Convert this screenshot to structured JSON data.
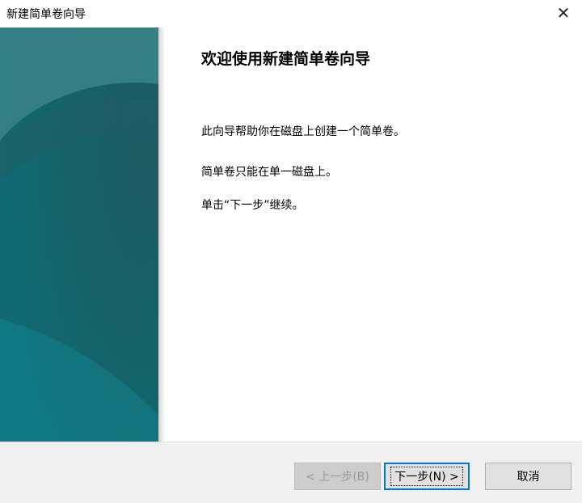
{
  "window": {
    "title": "新建简单卷向导",
    "close_glyph": "✕"
  },
  "content": {
    "heading": "欢迎使用新建简单卷向导",
    "paragraphs": [
      "此向导帮助你在磁盘上创建一个简单卷。",
      "简单卷只能在单一磁盘上。",
      "单击“下一步”继续。"
    ]
  },
  "buttons": {
    "back": "< 上一步(B)",
    "next": "下一步(N) >",
    "cancel": "取消"
  },
  "colors": {
    "accent": "#0078d7",
    "panel_dark": "#16676f",
    "panel_light": "#12858c"
  }
}
